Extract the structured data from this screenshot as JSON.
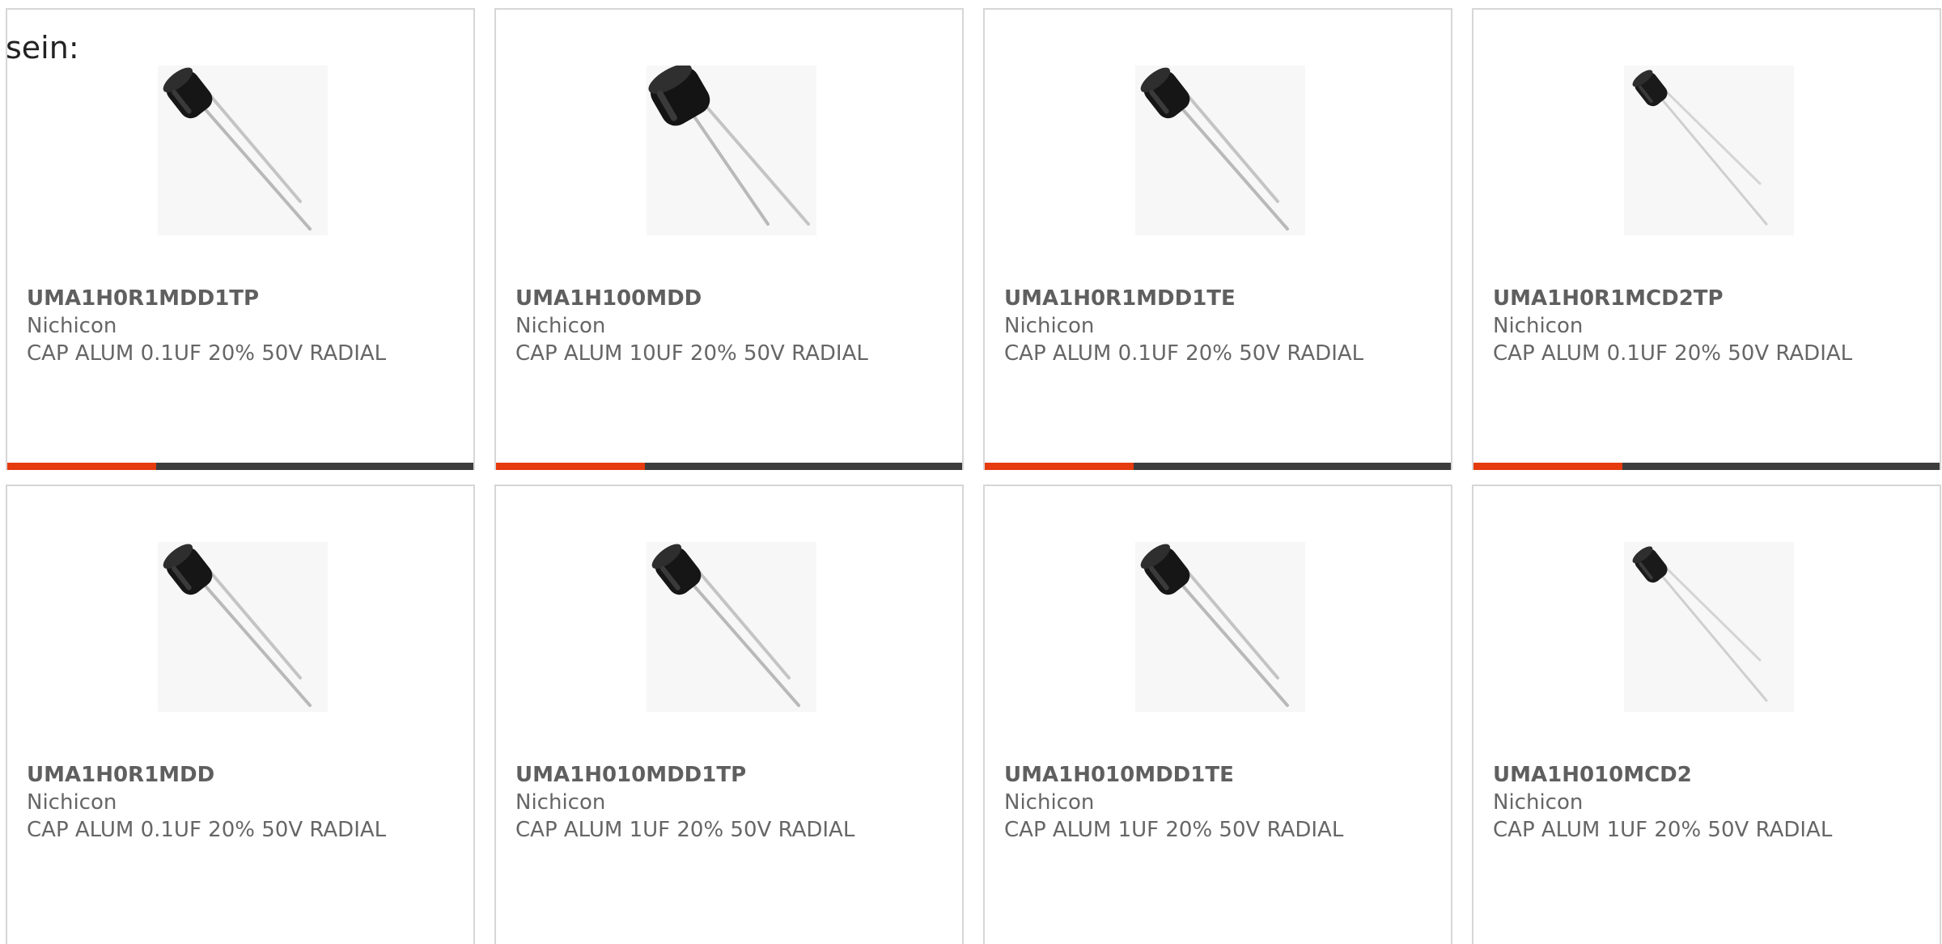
{
  "intro_text": "sein:",
  "colors": {
    "accent": "#e63b0e",
    "bar": "#3c3c3c",
    "border": "#d6d6d6",
    "text": "#666666"
  },
  "products": [
    {
      "part_number": "UMA1H0R1MDD1TP",
      "manufacturer": "Nichicon",
      "description": "CAP ALUM 0.1UF 20% 50V RADIAL",
      "icon": "capacitor-image"
    },
    {
      "part_number": "UMA1H100MDD",
      "manufacturer": "Nichicon",
      "description": "CAP ALUM 10UF 20% 50V RADIAL",
      "icon": "capacitor-image"
    },
    {
      "part_number": "UMA1H0R1MDD1TE",
      "manufacturer": "Nichicon",
      "description": "CAP ALUM 0.1UF 20% 50V RADIAL",
      "icon": "capacitor-image"
    },
    {
      "part_number": "UMA1H0R1MCD2TP",
      "manufacturer": "Nichicon",
      "description": "CAP ALUM 0.1UF 20% 50V RADIAL",
      "icon": "capacitor-image"
    },
    {
      "part_number": "UMA1H0R1MDD",
      "manufacturer": "Nichicon",
      "description": "CAP ALUM 0.1UF 20% 50V RADIAL",
      "icon": "capacitor-image"
    },
    {
      "part_number": "UMA1H010MDD1TP",
      "manufacturer": "Nichicon",
      "description": "CAP ALUM 1UF 20% 50V RADIAL",
      "icon": "capacitor-image"
    },
    {
      "part_number": "UMA1H010MDD1TE",
      "manufacturer": "Nichicon",
      "description": "CAP ALUM 1UF 20% 50V RADIAL",
      "icon": "capacitor-image"
    },
    {
      "part_number": "UMA1H010MCD2",
      "manufacturer": "Nichicon",
      "description": "CAP ALUM 1UF 20% 50V RADIAL",
      "icon": "capacitor-image"
    }
  ]
}
